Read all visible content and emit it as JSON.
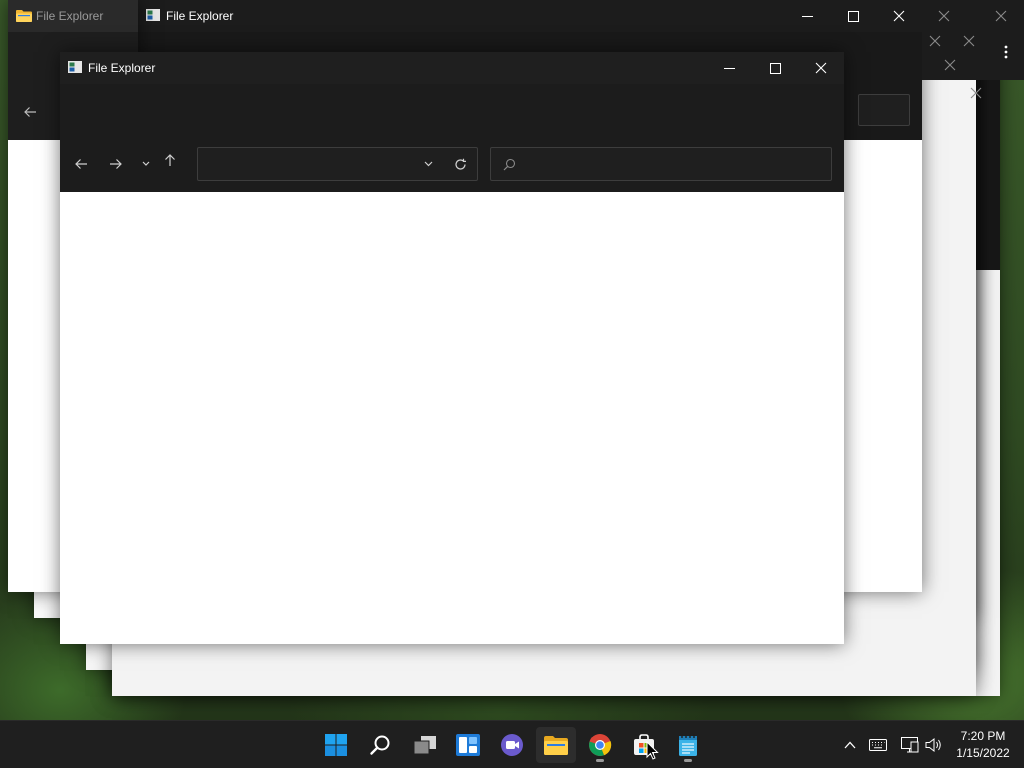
{
  "windows": {
    "back_left": {
      "title": "File Explorer"
    },
    "back_mid": {
      "title": "File Explorer"
    },
    "front": {
      "title": "File Explorer"
    }
  },
  "front_window": {
    "address_value": "",
    "search_placeholder": ""
  },
  "taskbar": {
    "pinned": [
      {
        "name": "Start",
        "icon": "windows-logo-icon"
      },
      {
        "name": "Search",
        "icon": "search-icon"
      },
      {
        "name": "Task View",
        "icon": "task-view-icon"
      },
      {
        "name": "Widgets",
        "icon": "widgets-icon"
      },
      {
        "name": "Chat",
        "icon": "chat-icon"
      },
      {
        "name": "File Explorer",
        "icon": "folder-icon"
      },
      {
        "name": "Google Chrome",
        "icon": "chrome-icon"
      },
      {
        "name": "Microsoft Store",
        "icon": "store-icon"
      },
      {
        "name": "Notepad",
        "icon": "notepad-icon"
      }
    ],
    "tray": {
      "time": "7:20 PM",
      "date": "1/15/2022"
    }
  },
  "colors": {
    "titlebar": "#1c1c1c",
    "toolbar": "#191919",
    "content": "#ffffff",
    "taskbar": "#1f1f1f",
    "accent_blue": "#0078d4"
  }
}
